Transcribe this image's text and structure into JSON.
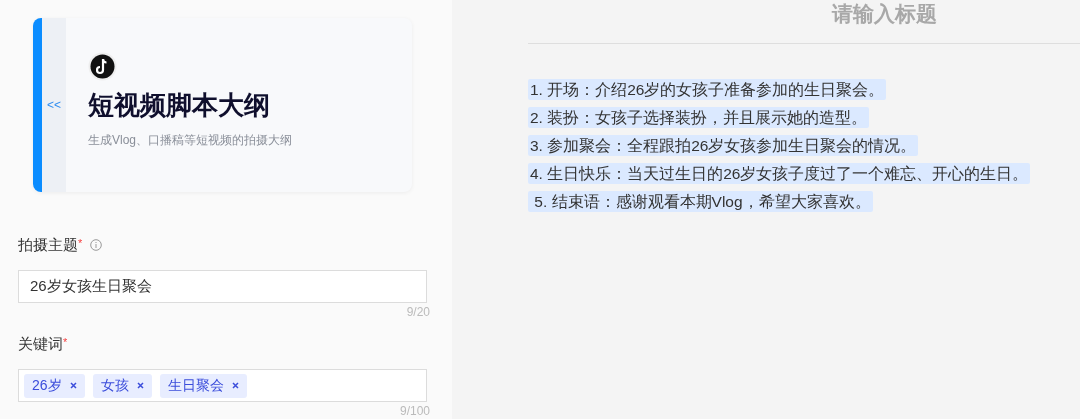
{
  "card": {
    "collapse": "<<",
    "title": "短视频脚本大纲",
    "subtitle": "生成Vlog、口播稿等短视频的拍摄大纲"
  },
  "fields": [
    {
      "kind": "text",
      "label": "拍摄主题",
      "required_mark": "*",
      "info": true,
      "value": "26岁女孩生日聚会",
      "counter": "9/20"
    },
    {
      "kind": "tags",
      "label": "关键词",
      "required_mark": "*",
      "tags": [
        "26岁",
        "女孩",
        "生日聚会"
      ],
      "counter": "9/100"
    }
  ],
  "editor": {
    "title_placeholder": "请输入标题",
    "lines": [
      {
        "text": "1. 开场：介绍26岁的女孩子准备参加的生日聚会。",
        "highlighted": true
      },
      {
        "text": "2. 装扮：女孩子选择装扮，并且展示她的造型。",
        "highlighted": true
      },
      {
        "text": "3. 参加聚会：全程跟拍26岁女孩参加生日聚会的情况。",
        "highlighted": true
      },
      {
        "text": "4. 生日快乐：当天过生日的26岁女孩子度过了一个难忘、开心的生日。",
        "highlighted": true
      },
      {
        "text": " 5. 结束语：感谢观看本期Vlog，希望大家喜欢。",
        "highlighted": true
      }
    ]
  }
}
